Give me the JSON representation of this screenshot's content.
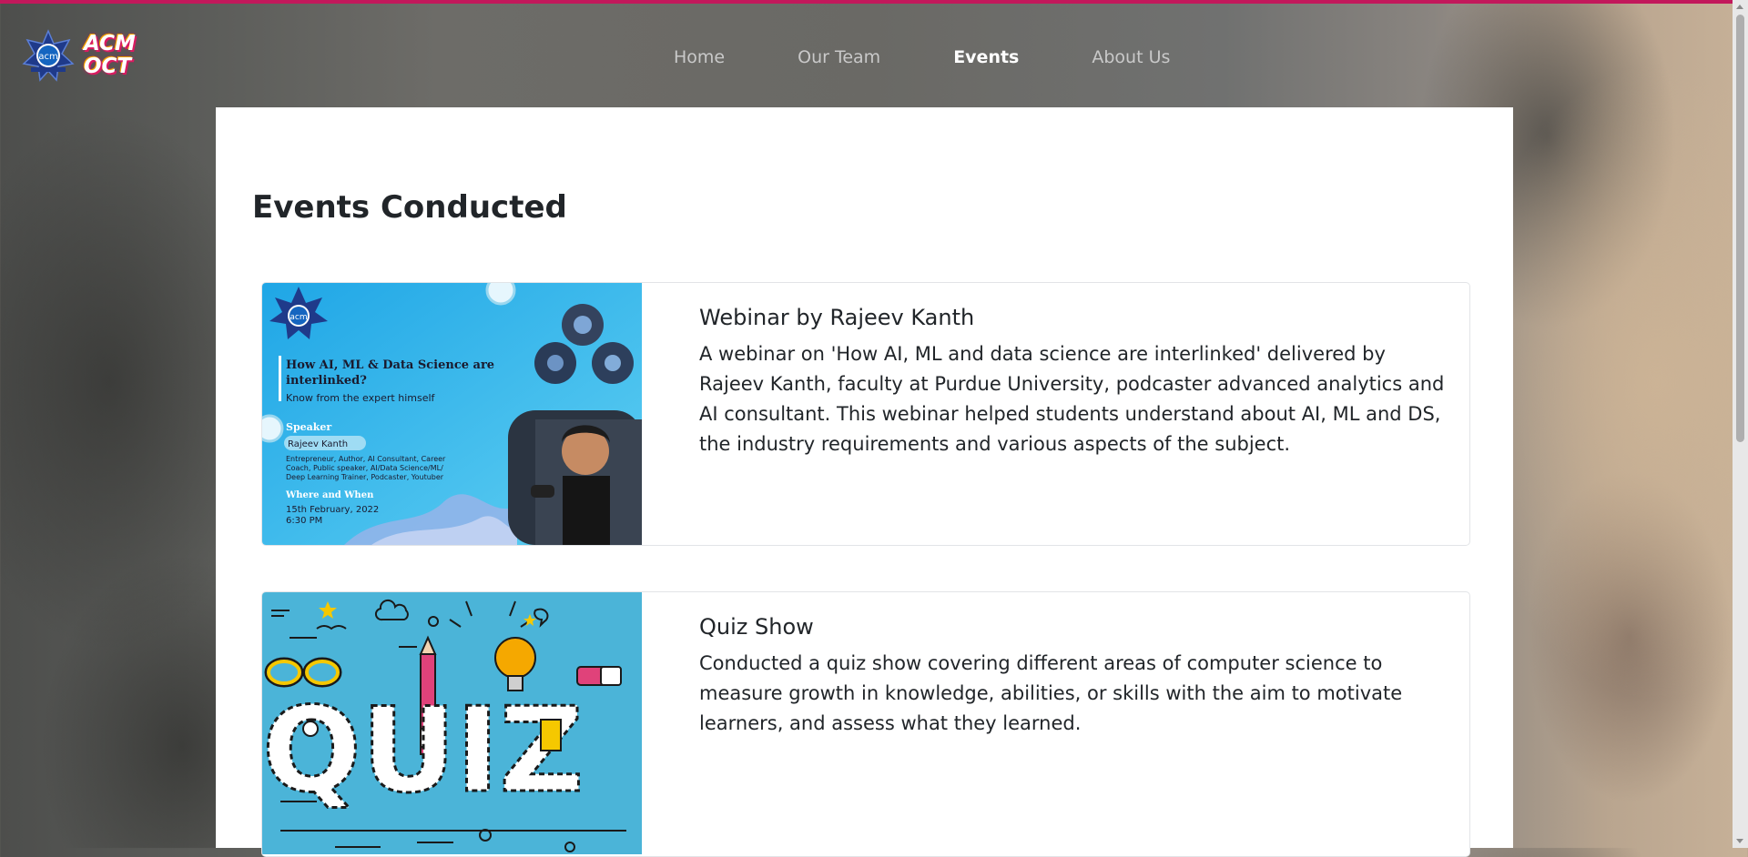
{
  "nav": {
    "items": [
      {
        "label": "Home"
      },
      {
        "label": "Our Team"
      },
      {
        "label": "Events"
      },
      {
        "label": "About Us"
      }
    ],
    "active": "Events"
  },
  "logo": {
    "acm_text": "acm",
    "oct_line1": "ACM",
    "oct_line2": "OCT"
  },
  "page_title": "Events Conducted",
  "events": [
    {
      "title": "Webinar by Rajeev Kanth",
      "description": "A webinar on 'How AI, ML and data science are interlinked' delivered by Rajeev Kanth, faculty at Purdue University, podcaster advanced analytics and AI consultant. This webinar helped students understand about AI, ML and DS, the industry requirements and various aspects of the subject.",
      "poster": {
        "logo_text": "acm",
        "heading_line1": "How AI, ML & Data Science are",
        "heading_line2": "interlinked?",
        "tagline": "Know from the expert himself",
        "speaker_label": "Speaker",
        "speaker_name": "Rajeev Kanth",
        "speaker_desc_1": "Entrepreneur, Author, AI Consultant, Career",
        "speaker_desc_2": "Coach, Public speaker, AI/Data Science/ML/",
        "speaker_desc_3": "Deep Learning Trainer, Podcaster, Youtuber",
        "when_label": "Where and When",
        "date": "15th February, 2022",
        "time": "6:30 PM"
      }
    },
    {
      "title": "Quiz Show",
      "description": "Conducted a quiz show covering different areas of computer science to measure growth in knowledge, abilities, or skills with the aim to motivate learners, and assess what they learned.",
      "poster": {
        "word": "QUIZ"
      }
    }
  ],
  "colors": {
    "accent_top": "#c2185b",
    "poster_blue": "#3ab0e2",
    "quiz_bg": "#4bb4d8"
  }
}
